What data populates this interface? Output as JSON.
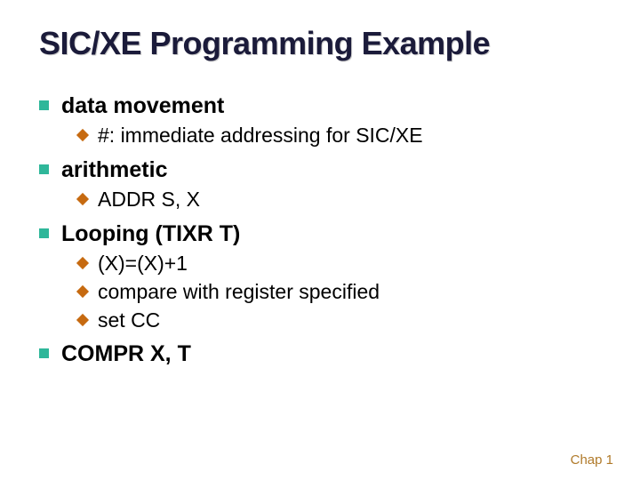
{
  "title": "SIC/XE Programming Example",
  "items": [
    {
      "label": "data movement",
      "sub": [
        {
          "text": "#:  immediate addressing for SIC/XE"
        }
      ]
    },
    {
      "label": "arithmetic",
      "sub": [
        {
          "text": "ADDR  S, X"
        }
      ]
    },
    {
      "label": "Looping (TIXR T)",
      "sub": [
        {
          "text": "(X)=(X)+1"
        },
        {
          "text": "compare with register specified"
        },
        {
          "text": "set  CC"
        }
      ]
    },
    {
      "label": "COMPR  X, T",
      "sub": []
    }
  ],
  "footer": "Chap 1"
}
